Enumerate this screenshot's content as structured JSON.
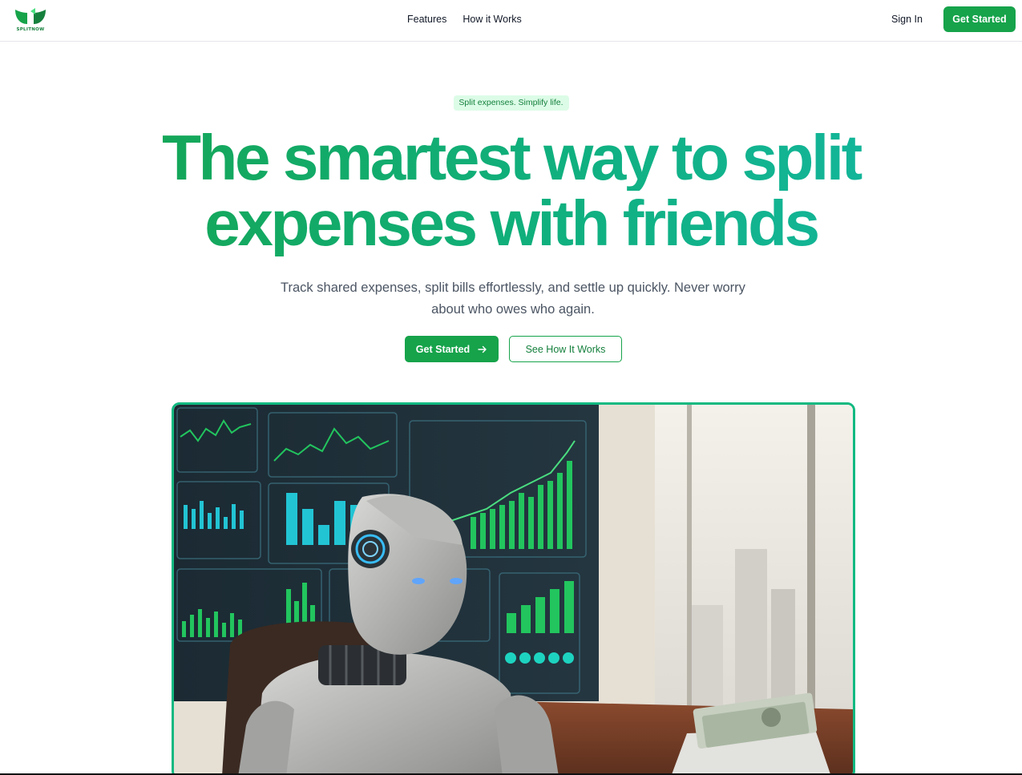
{
  "header": {
    "logo_text": "SPLITNOW",
    "nav": [
      {
        "label": "Features"
      },
      {
        "label": "How it Works"
      }
    ],
    "sign_in_label": "Sign In",
    "get_started_label": "Get Started"
  },
  "hero": {
    "badge": "Split expenses. Simplify life.",
    "headline_line1": "The smartest way to split",
    "headline_line2": "expenses with friends",
    "subtitle": "Track shared expenses, split bills effortlessly, and settle up quickly. Never worry about who owes who again.",
    "primary_cta": "Get Started",
    "primary_cta_icon": "arrow-right-icon",
    "secondary_cta": "See How It Works",
    "image_subject": "robot-at-desk-with-stock-charts-and-cash"
  },
  "colors": {
    "brand_green": "#16a34a",
    "accent_teal": "#14b8a6",
    "badge_bg": "#dcfce7"
  }
}
